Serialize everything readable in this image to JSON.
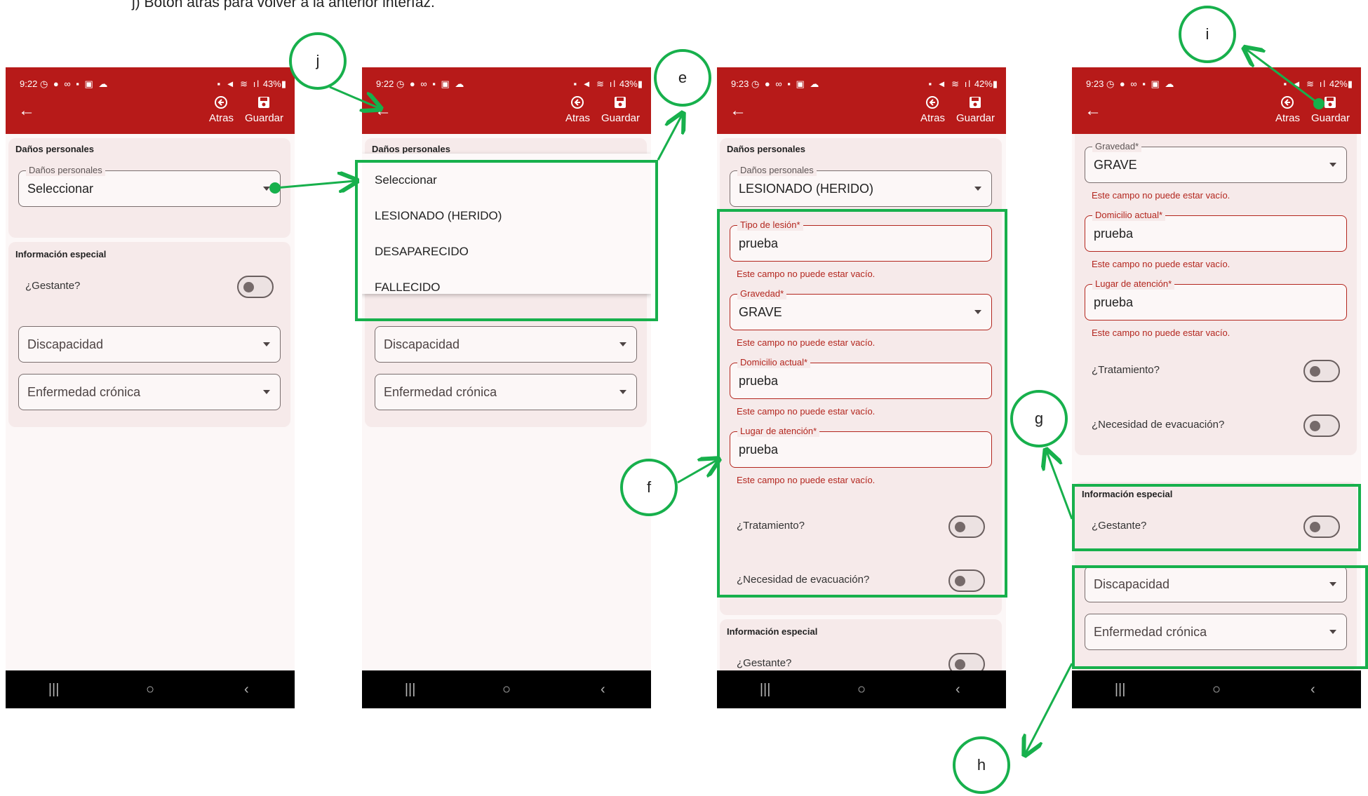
{
  "caption": "j)   Botón atrás para volver a la anterior interfaz.",
  "colors": {
    "appbar": "#b71a19",
    "annotation": "#17b04c",
    "error": "#b3261e"
  },
  "bubbles": {
    "e": "e",
    "f": "f",
    "g": "g",
    "h": "h",
    "i": "i",
    "j": "j"
  },
  "phone1": {
    "status": {
      "time": "9:22",
      "battery": "43%"
    },
    "actions": {
      "back": "Atras",
      "save": "Guardar"
    },
    "personal_title": "Daños personales",
    "danos_field": {
      "label": "Daños personales",
      "value": "Seleccionar"
    },
    "special_title": "Información especial",
    "gestante": "¿Gestante?",
    "discapacidad": "Discapacidad",
    "enfermedad": "Enfermedad crónica"
  },
  "phone2": {
    "status": {
      "time": "9:22",
      "battery": "43%"
    },
    "actions": {
      "back": "Atras",
      "save": "Guardar"
    },
    "personal_title": "Daños personales",
    "menu_items": [
      "Seleccionar",
      "LESIONADO (HERIDO)",
      "DESAPARECIDO",
      "FALLECIDO"
    ],
    "discapacidad": "Discapacidad",
    "enfermedad": "Enfermedad crónica"
  },
  "phone3": {
    "status": {
      "time": "9:23",
      "battery": "42%"
    },
    "actions": {
      "back": "Atras",
      "save": "Guardar"
    },
    "personal_title": "Daños personales",
    "danos_field": {
      "label": "Daños personales",
      "value": "LESIONADO (HERIDO)"
    },
    "tipo_lesion": {
      "label": "Tipo de lesión*",
      "value": "prueba"
    },
    "gravedad": {
      "label": "Gravedad*",
      "value": "GRAVE"
    },
    "domicilio": {
      "label": "Domicilio actual*",
      "value": "prueba"
    },
    "lugar": {
      "label": "Lugar de atención*",
      "value": "prueba"
    },
    "error_msg": "Este campo no puede estar vacío.",
    "tratamiento": "¿Tratamiento?",
    "evacuacion": "¿Necesidad de evacuación?",
    "special_title": "Información especial",
    "gestante": "¿Gestante?"
  },
  "phone4": {
    "status": {
      "time": "9:23",
      "battery": "42%"
    },
    "actions": {
      "back": "Atras",
      "save": "Guardar"
    },
    "gravedad": {
      "label": "Gravedad*",
      "value": "GRAVE"
    },
    "domicilio": {
      "label": "Domicilio actual*",
      "value": "prueba"
    },
    "lugar": {
      "label": "Lugar de atención*",
      "value": "prueba"
    },
    "error_msg": "Este campo no puede estar vacío.",
    "tratamiento": "¿Tratamiento?",
    "evacuacion": "¿Necesidad de evacuación?",
    "special_title": "Información especial",
    "gestante": "¿Gestante?",
    "discapacidad": "Discapacidad",
    "enfermedad": "Enfermedad crónica"
  }
}
